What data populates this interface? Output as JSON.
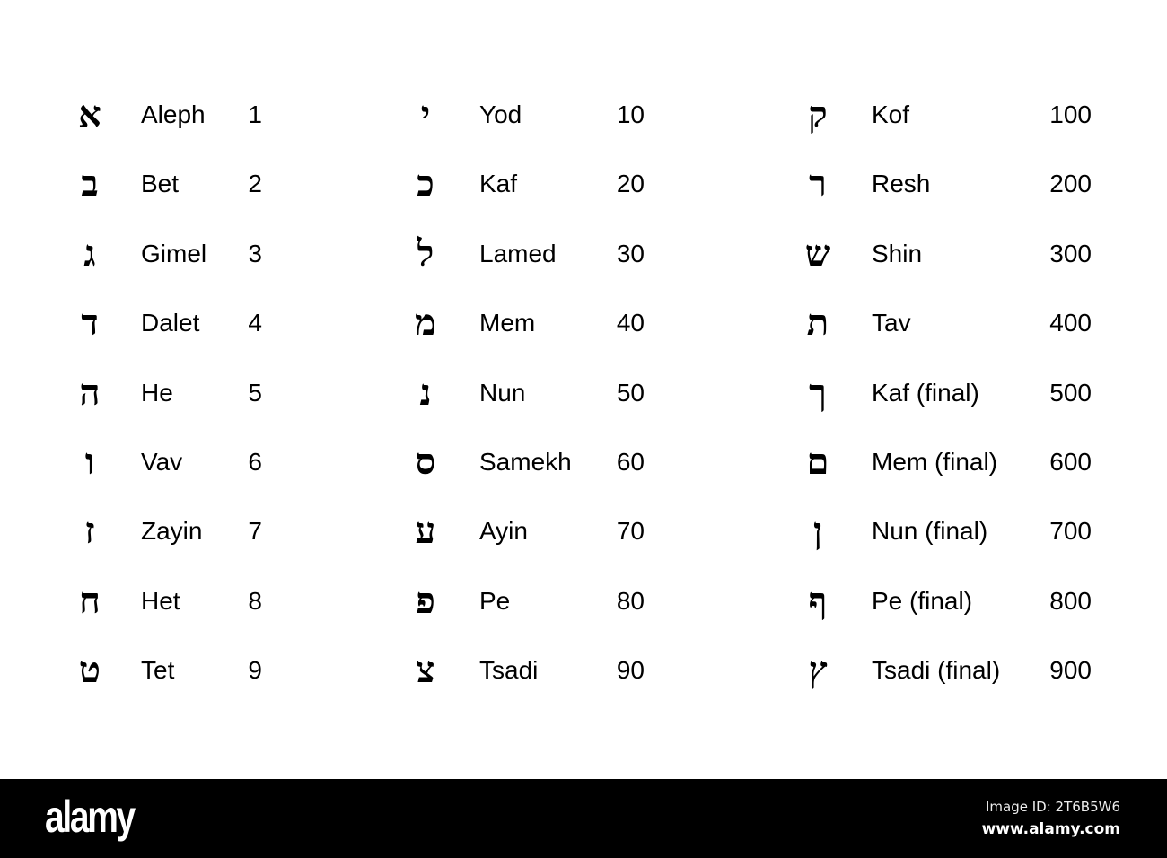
{
  "columns": [
    {
      "rows": [
        {
          "letter": "א",
          "name": "Aleph",
          "value": "1"
        },
        {
          "letter": "ב",
          "name": "Bet",
          "value": "2"
        },
        {
          "letter": "ג",
          "name": "Gimel",
          "value": "3"
        },
        {
          "letter": "ד",
          "name": "Dalet",
          "value": "4"
        },
        {
          "letter": "ה",
          "name": "He",
          "value": "5"
        },
        {
          "letter": "ו",
          "name": "Vav",
          "value": "6"
        },
        {
          "letter": "ז",
          "name": "Zayin",
          "value": "7"
        },
        {
          "letter": "ח",
          "name": "Het",
          "value": "8"
        },
        {
          "letter": "ט",
          "name": "Tet",
          "value": "9"
        }
      ]
    },
    {
      "rows": [
        {
          "letter": "י",
          "name": "Yod",
          "value": "10"
        },
        {
          "letter": "כ",
          "name": "Kaf",
          "value": "20"
        },
        {
          "letter": "ל",
          "name": "Lamed",
          "value": "30"
        },
        {
          "letter": "מ",
          "name": "Mem",
          "value": "40"
        },
        {
          "letter": "נ",
          "name": "Nun",
          "value": "50"
        },
        {
          "letter": "ס",
          "name": "Samekh",
          "value": "60"
        },
        {
          "letter": "ע",
          "name": "Ayin",
          "value": "70"
        },
        {
          "letter": "פ",
          "name": "Pe",
          "value": "80"
        },
        {
          "letter": "צ",
          "name": "Tsadi",
          "value": "90"
        }
      ]
    },
    {
      "rows": [
        {
          "letter": "ק",
          "name": "Kof",
          "value": "100"
        },
        {
          "letter": "ר",
          "name": "Resh",
          "value": "200"
        },
        {
          "letter": "ש",
          "name": "Shin",
          "value": "300"
        },
        {
          "letter": "ת",
          "name": "Tav",
          "value": "400"
        },
        {
          "letter": "ך",
          "name": "Kaf (final)",
          "value": "500"
        },
        {
          "letter": "ם",
          "name": "Mem (final)",
          "value": "600"
        },
        {
          "letter": "ן",
          "name": "Nun (final)",
          "value": "700"
        },
        {
          "letter": "ף",
          "name": "Pe (final)",
          "value": "800"
        },
        {
          "letter": "ץ",
          "name": "Tsadi (final)",
          "value": "900"
        }
      ]
    }
  ],
  "footer": {
    "brand": "alamy",
    "image_id": "Image ID: 2T6B5W6",
    "site_url": "www.alamy.com",
    "background_color": "#000000",
    "text_color": "#ffffff"
  }
}
